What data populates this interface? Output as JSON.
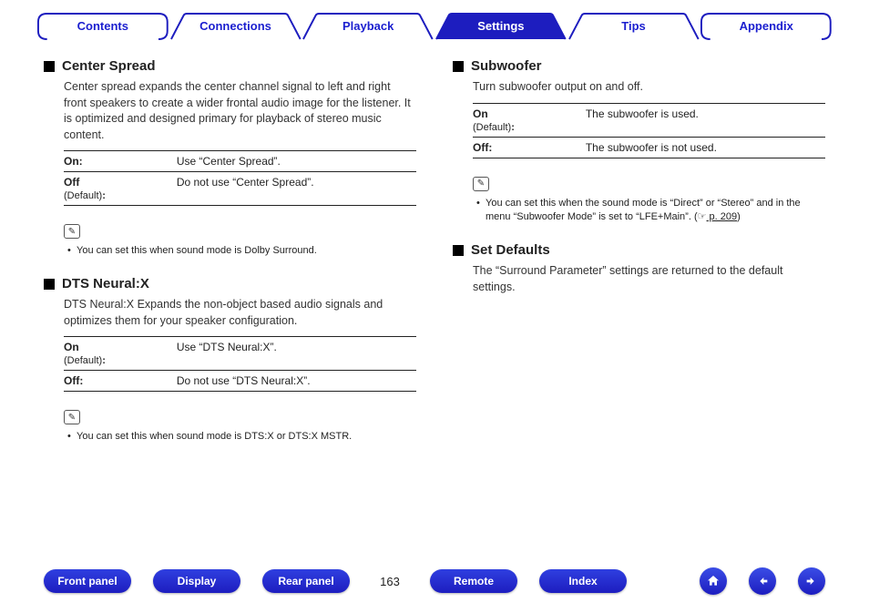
{
  "tabs": {
    "items": [
      {
        "label": "Contents",
        "active": false
      },
      {
        "label": "Connections",
        "active": false
      },
      {
        "label": "Playback",
        "active": false
      },
      {
        "label": "Settings",
        "active": true
      },
      {
        "label": "Tips",
        "active": false
      },
      {
        "label": "Appendix",
        "active": false
      }
    ]
  },
  "left": {
    "centerSpread": {
      "title": "Center Spread",
      "desc": "Center spread expands the center channel signal to left and right front speakers to create a wider frontal audio image for the listener. It is optimized and designed primary for playback of stereo music content.",
      "rows": [
        {
          "k1": "On:",
          "k2": "",
          "val": "Use “Center Spread”."
        },
        {
          "k1": "Off",
          "k2": "(Default)",
          "val": "Do not use “Center Spread”."
        }
      ],
      "note": "You can set this when sound mode is Dolby Surround."
    },
    "dts": {
      "title": "DTS Neural:X",
      "desc": "DTS Neural:X Expands the non-object based audio signals and optimizes them for your speaker configuration.",
      "rows": [
        {
          "k1": "On",
          "k2": "(Default)",
          "val": "Use “DTS Neural:X”."
        },
        {
          "k1": "Off:",
          "k2": "",
          "val": "Do not use “DTS Neural:X”."
        }
      ],
      "note": "You can set this when sound mode is DTS:X or DTS:X MSTR."
    }
  },
  "right": {
    "sub": {
      "title": "Subwoofer",
      "desc": "Turn subwoofer output on and off.",
      "rows": [
        {
          "k1": "On",
          "k2": "(Default)",
          "val": "The subwoofer is used."
        },
        {
          "k1": "Off:",
          "k2": "",
          "val": "The subwoofer is not used."
        }
      ],
      "noteA": "You can set this when the sound mode is “Direct” or “Stereo” and in the menu “Subwoofer Mode” is set to “LFE+Main”.  (",
      "noteLink": " p. 209",
      "noteB": ")"
    },
    "defaults": {
      "title": "Set Defaults",
      "desc": "The “Surround Parameter” settings are returned to the default settings."
    }
  },
  "footer": {
    "front": "Front panel",
    "display": "Display",
    "rear": "Rear panel",
    "page": "163",
    "remote": "Remote",
    "index": "Index"
  },
  "icons": {
    "pencil": "✎",
    "pointer": "☞"
  }
}
